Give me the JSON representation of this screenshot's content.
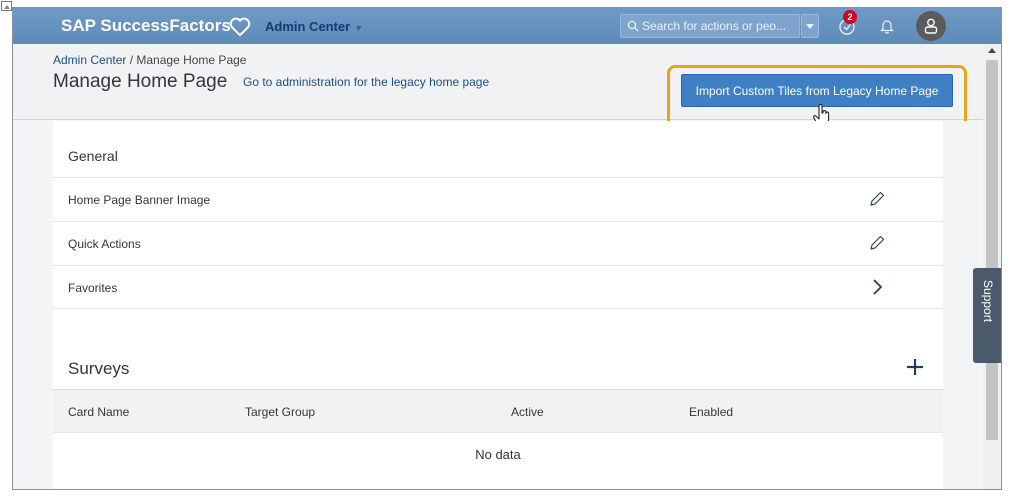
{
  "shell": {
    "brand": "SAP SuccessFactors",
    "menu_label": "Admin Center",
    "search_placeholder": "Search for actions or peo...",
    "notification_count": "2"
  },
  "page_header": {
    "breadcrumb_root": "Admin Center",
    "breadcrumb_separator": " / ",
    "breadcrumb_current": "Manage Home Page",
    "title": "Manage Home Page",
    "legacy_link": "Go to administration for the legacy home page",
    "import_button": "Import Custom Tiles from Legacy Home Page",
    "highlight_color": "#e8a317",
    "button_color": "#3f7fc4"
  },
  "general": {
    "title": "General",
    "rows": [
      {
        "label": "Home Page Banner Image",
        "action": "pencil-icon"
      },
      {
        "label": "Quick Actions",
        "action": "pencil-icon"
      },
      {
        "label": "Favorites",
        "action": "chevron-right-icon"
      }
    ]
  },
  "surveys": {
    "title": "Surveys",
    "columns": [
      "Card Name",
      "Target Group",
      "Active",
      "Enabled"
    ],
    "empty_text": "No data"
  },
  "support": {
    "label": "Support"
  }
}
